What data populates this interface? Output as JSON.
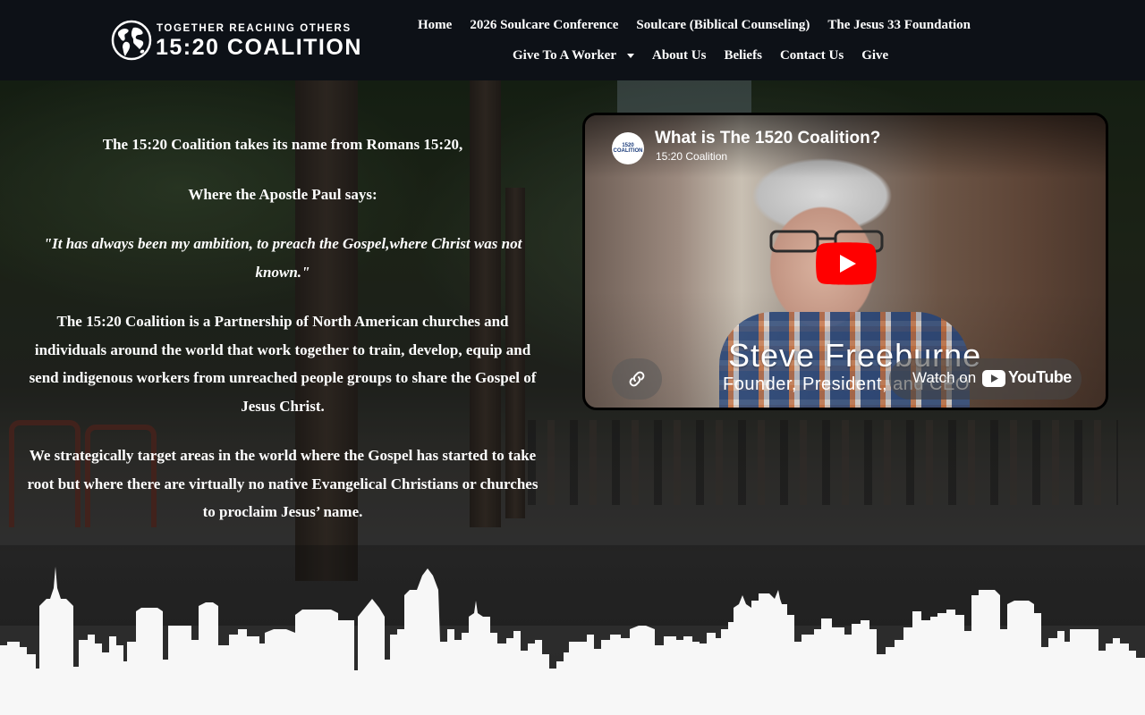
{
  "header": {
    "logo": {
      "tagline": "TOGETHER REACHING OTHERS",
      "name": "15:20 COALITION",
      "icon": "globe-icon"
    },
    "nav_row1": [
      "Home",
      "2026 Soulcare Conference",
      "Soulcare (Biblical Counseling)",
      "The Jesus 33 Foundation"
    ],
    "nav_row2": {
      "give_to_worker": "Give To A Worker",
      "about": "About Us",
      "beliefs": "Beliefs",
      "contact": "Contact Us",
      "give": "Give"
    }
  },
  "hero": {
    "paragraphs": {
      "intro": "The 15:20 Coalition takes its name from Romans 15:20,",
      "where": "Where the Apostle Paul says:",
      "quote": "\"It has always been my ambition, to preach the Gospel,where Christ was not known.\"",
      "partnership": "The 15:20 Coalition is a Partnership of North American churches and individuals around the world that work together to train, develop, equip and send indigenous workers from unreached people groups to share the Gospel of Jesus Christ.",
      "strategy": "We strategically target areas in the world where the Gospel has started to take root but where there are virtually no native Evangelical Christians or churches to proclaim Jesus’ name."
    }
  },
  "video": {
    "title": "What is The 1520 Coalition?",
    "channel": "15:20 Coalition",
    "avatar_text": "1520 COALITION",
    "lower_third_name": "Steve Freeburne",
    "lower_third_role": "Founder, President, and CEO",
    "watch_on": "Watch on",
    "youtube": "YouTube",
    "icons": [
      "play-icon",
      "link-icon",
      "youtube-icon"
    ],
    "colors": {
      "play": "#ff0000"
    }
  },
  "colors": {
    "header_bg": "#0d1117",
    "text": "#ffffff",
    "skyline": "#f7f7f7"
  }
}
